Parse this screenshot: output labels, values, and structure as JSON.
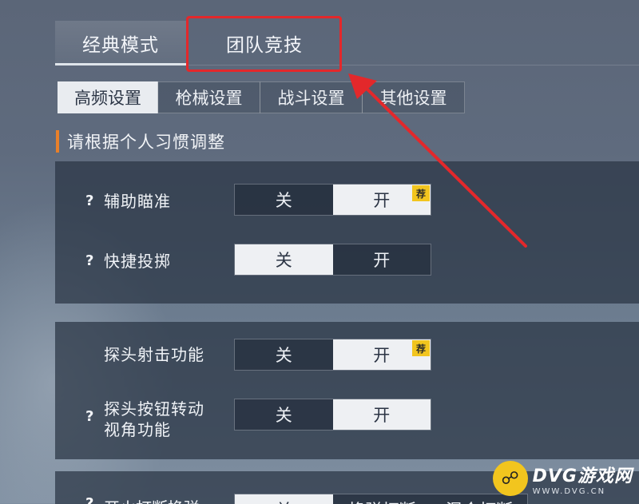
{
  "mode_tabs": [
    "经典模式",
    "团队竞技"
  ],
  "sub_tabs": [
    "高频设置",
    "枪械设置",
    "战斗设置",
    "其他设置"
  ],
  "hint": "请根据个人习惯调整",
  "settings": {
    "aim_assist": {
      "label": "辅助瞄准",
      "off": "关",
      "on": "开",
      "selected": "on",
      "recommended": "荐"
    },
    "quick_throw": {
      "label": "快捷投掷",
      "off": "关",
      "on": "开",
      "selected": "off"
    },
    "peek_fire": {
      "label": "探头射击功能",
      "off": "关",
      "on": "开",
      "selected": "on",
      "recommended": "荐"
    },
    "peek_button_rotate": {
      "label_line1": "探头按钮转动",
      "label_line2": "视角功能",
      "off": "关",
      "on": "开",
      "selected": "on"
    }
  },
  "partial_row": {
    "label": "开火打断换弹",
    "opt_off": "关",
    "opt_a": "换弹打断",
    "opt_b": "混合打断"
  },
  "help_mark": "?",
  "watermark": {
    "brand": "DVG游戏网",
    "url": "WWW.DVG.CN"
  },
  "colors": {
    "highlight": "#e3282b",
    "accent": "#e8802a",
    "badge": "#f2c51e"
  }
}
